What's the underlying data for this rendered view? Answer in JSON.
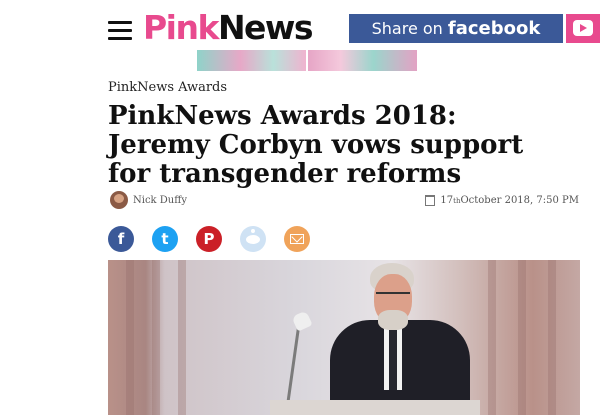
{
  "header": {
    "logo_pink": "Pink",
    "logo_dark": "News",
    "share_prefix": "Share on ",
    "share_brand": "facebook"
  },
  "article": {
    "category": "PinkNews Awards",
    "title": "PinkNews Awards 2018: Jeremy Corbyn vows support for transgender reforms",
    "author": "Nick Duffy",
    "date_day": "17",
    "date_suffix": "th",
    "date_rest": " October 2018, 7:50 PM"
  },
  "share_buttons": [
    {
      "name": "facebook",
      "glyph": "f"
    },
    {
      "name": "twitter",
      "glyph": "t"
    },
    {
      "name": "pinterest",
      "glyph": "P"
    },
    {
      "name": "reddit",
      "glyph": ""
    },
    {
      "name": "email",
      "glyph": ""
    }
  ],
  "colors": {
    "brand_pink": "#e84a8e",
    "facebook_blue": "#3b5998",
    "twitter_blue": "#1da1f2",
    "pinterest_red": "#cb2027",
    "email_orange": "#f0a35a"
  },
  "icons": [
    "menu-icon",
    "youtube-icon",
    "calendar-icon"
  ]
}
